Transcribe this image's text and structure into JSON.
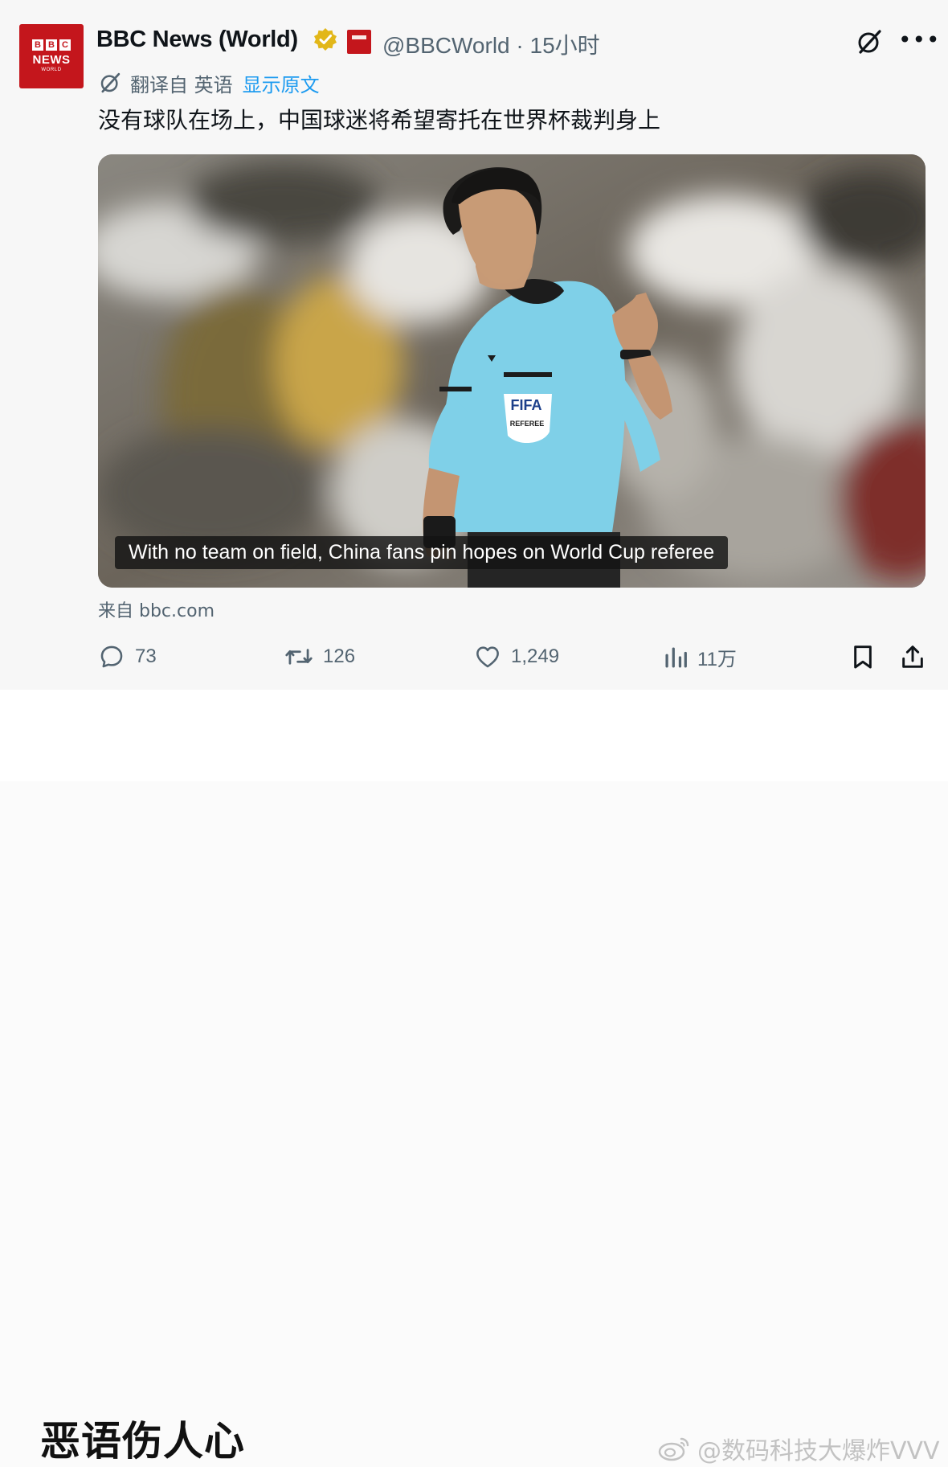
{
  "account": {
    "display_name": "BBC News (World)",
    "handle_time": "@BBCWorld · 15小时",
    "avatar": {
      "line1": [
        "B",
        "B",
        "C"
      ],
      "line2": "NEWS",
      "line3": "WORLD",
      "color": "#c4161c"
    },
    "verified_color": "#e2b719"
  },
  "translation": {
    "label": "翻译自 英语",
    "link": "显示原文"
  },
  "tweet_text": "没有球队在场上，中国球迷将希望寄托在世界杯裁判身上",
  "media": {
    "caption": "With no team on field, China fans pin hopes on World Cup referee",
    "jersey_text": "FIFA",
    "badge_text": "REFEREE"
  },
  "source": "来自 bbc.com",
  "actions": {
    "replies": "73",
    "retweets": "126",
    "likes": "1,249",
    "views": "11万"
  },
  "bottom": {
    "headline": "恶语伤人心",
    "watermark": "@数码科技大爆炸VVV"
  }
}
